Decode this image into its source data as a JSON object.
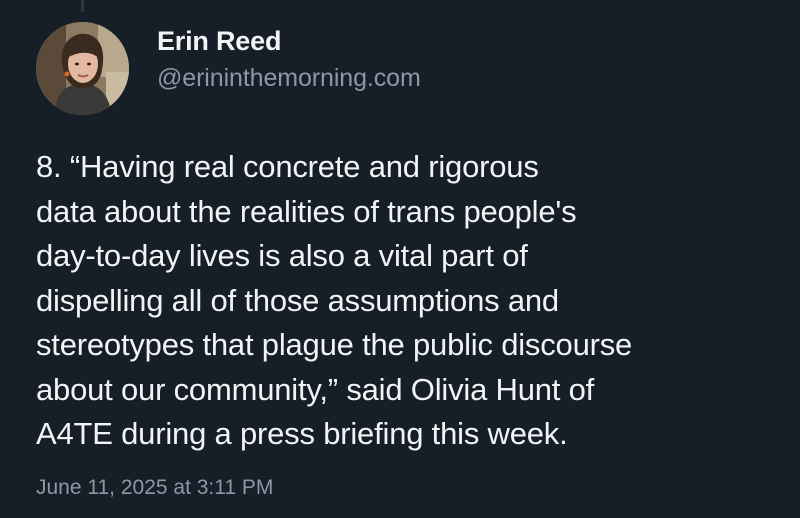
{
  "author": {
    "name": "Erin Reed",
    "handle": "@erininthemorning.com",
    "avatar_icon": "user-avatar-photo"
  },
  "post": {
    "text_lines": [
      "8. “Having real concrete and rigorous",
      "data about the realities of trans people's",
      "day-to-day lives is also a vital part of",
      "dispelling all of those assumptions and",
      "stereotypes that plague the public discourse",
      "about our community,” said Olivia Hunt of",
      "A4TE during a press briefing this week."
    ],
    "timestamp": "June 11, 2025 at 3:11 PM"
  },
  "colors": {
    "background": "#161e27",
    "primary_text": "#f1f3f5",
    "secondary_text": "#8b98a5",
    "thread_line": "#2e3945"
  }
}
